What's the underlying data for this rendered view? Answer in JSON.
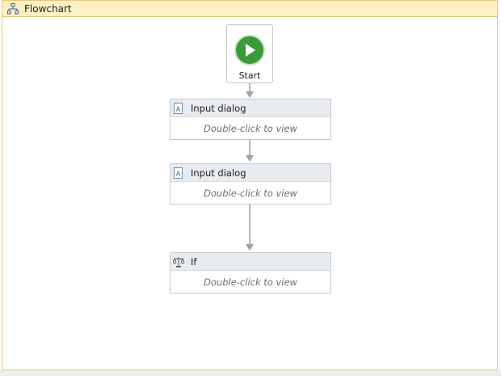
{
  "header": {
    "title": "Flowchart",
    "icon": "flowchart-icon"
  },
  "start_node": {
    "label": "Start",
    "icon": "play-icon"
  },
  "activities": [
    {
      "title": "Input dialog",
      "hint": "Double-click to view",
      "icon": "input-dialog-icon"
    },
    {
      "title": "Input dialog",
      "hint": "Double-click to view",
      "icon": "input-dialog-icon"
    },
    {
      "title": "If",
      "hint": "Double-click to view",
      "icon": "if-icon"
    }
  ],
  "colors": {
    "title_bar": "#fdf1c4",
    "border": "#e4c77a",
    "start_green": "#3a9a3a",
    "activity_header": "#e8ebef",
    "connector": "#a0a0a0"
  }
}
